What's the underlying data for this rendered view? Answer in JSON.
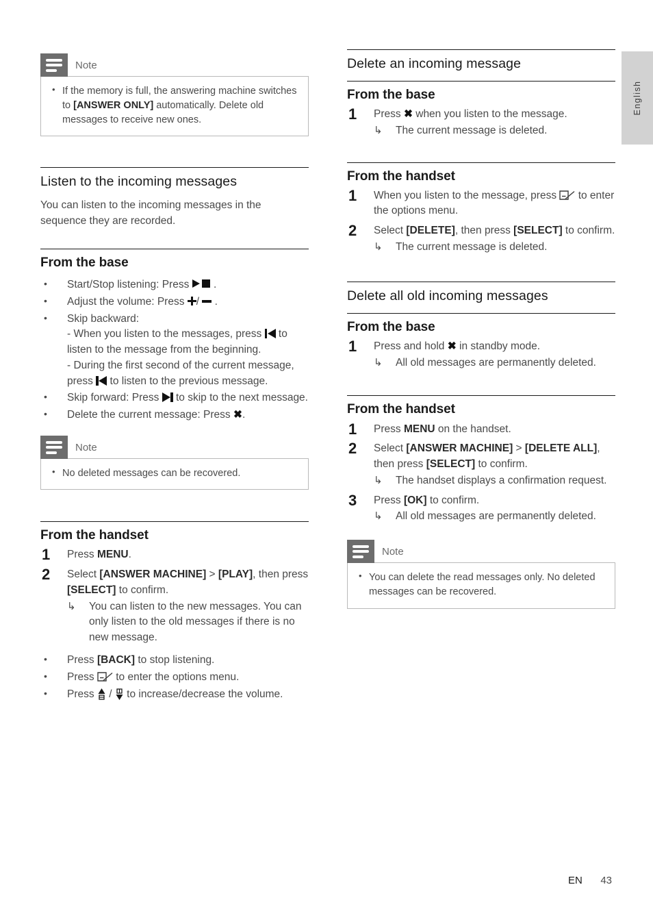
{
  "page": {
    "language_tab": "English",
    "footer_lang_code": "EN",
    "footer_page_number": "43"
  },
  "icons": {
    "note_badge": "note-lines-icon",
    "play_stop": "play-stop-icon",
    "volume_plus": "plus-icon",
    "volume_minus": "minus-icon",
    "skip_backward": "skip-backward-icon",
    "skip_forward": "skip-forward-icon",
    "delete_key": "x-delete-icon",
    "options_softkey": "softkey-options-icon",
    "volume_up_key": "volume-up-key-icon",
    "volume_down_key": "volume-down-key-icon"
  },
  "left_column": {
    "note_memory": {
      "title": "Note",
      "items": [
        {
          "pre": "If the memory is full, the answering machine switches to ",
          "bold": "[ANSWER ONLY]",
          "post": " automatically. Delete old messages to receive new ones."
        }
      ]
    },
    "listen_section": {
      "heading": "Listen to the incoming messages",
      "intro": "You can listen to the incoming messages in the sequence they are recorded.",
      "from_base": {
        "heading": "From the base",
        "bullets": {
          "start_stop_pre": "Start/Stop listening: Press ",
          "start_stop_post": " .",
          "volume_pre": "Adjust the volume: Press ",
          "volume_mid": "/",
          "volume_post": " .",
          "skip_backward_label": "Skip backward:",
          "skip_backward_line1_pre": "- When you listen to the messages, press ",
          "skip_backward_line1_post": " to listen to the message from the beginning.",
          "skip_backward_line2_pre": "- During the first second of the current message, press ",
          "skip_backward_line2_post": " to listen to the previous message.",
          "skip_forward_pre": "Skip forward: Press ",
          "skip_forward_post": " to skip to the next message.",
          "delete_pre": "Delete the current message: Press ",
          "delete_post": "."
        }
      },
      "note_recover": {
        "title": "Note",
        "items": [
          {
            "pre": "No deleted messages can be recovered.",
            "bold": "",
            "post": ""
          }
        ]
      },
      "from_handset": {
        "heading": "From the handset",
        "steps": [
          {
            "number": "1",
            "pre": "Press ",
            "bold": "MENU",
            "post": ".",
            "results": []
          },
          {
            "number": "2",
            "pre": "Select ",
            "bold": "[ANSWER MACHINE]",
            "mid": " > ",
            "bold2": "[PLAY]",
            "mid2": ", then press ",
            "bold3": "[SELECT]",
            "post": " to confirm.",
            "results": [
              "You can listen to the new messages. You can only listen to the old messages if there is no new message."
            ]
          }
        ],
        "bullets": {
          "back_pre": "Press ",
          "back_bold": "[BACK]",
          "back_post": " to stop listening.",
          "options_pre": "Press ",
          "options_post": " to enter the options menu.",
          "vol_pre": "Press ",
          "vol_mid": " / ",
          "vol_post": " to increase/decrease the volume."
        }
      }
    }
  },
  "right_column": {
    "delete_incoming": {
      "heading": "Delete an incoming message",
      "from_base": {
        "heading": "From the base",
        "steps": [
          {
            "number": "1",
            "pre": "Press ",
            "post": " when you listen to the message.",
            "results": [
              "The current message is deleted."
            ]
          }
        ]
      },
      "from_handset": {
        "heading": "From the handset",
        "steps": [
          {
            "number": "1",
            "pre": "When you listen to the message, press ",
            "post": " to enter the options menu.",
            "results": []
          },
          {
            "number": "2",
            "pre": "Select ",
            "bold": "[DELETE]",
            "mid": ", then press ",
            "bold2": "[SELECT]",
            "post": " to confirm.",
            "results": [
              "The current message is deleted."
            ]
          }
        ]
      }
    },
    "delete_all_old": {
      "heading": "Delete all old incoming messages",
      "from_base": {
        "heading": "From the base",
        "steps": [
          {
            "number": "1",
            "pre": "Press and hold ",
            "post": " in standby mode.",
            "results": [
              "All old messages are permanently deleted."
            ]
          }
        ]
      },
      "from_handset": {
        "heading": "From the handset",
        "steps": [
          {
            "number": "1",
            "pre": "Press ",
            "bold": "MENU",
            "post": " on the handset.",
            "results": []
          },
          {
            "number": "2",
            "pre": "Select ",
            "bold": "[ANSWER MACHINE]",
            "mid": " > ",
            "bold2": "[DELETE ALL]",
            "mid2": ", then press ",
            "bold3": "[SELECT]",
            "post": " to confirm.",
            "results": [
              "The handset displays a confirmation request."
            ]
          },
          {
            "number": "3",
            "pre": "Press ",
            "bold": "[OK]",
            "post": " to confirm.",
            "results": [
              "All old messages are permanently deleted."
            ]
          }
        ]
      },
      "note_read_only": {
        "title": "Note",
        "items": [
          {
            "pre": "You can delete the read messages only. No deleted messages can be recovered.",
            "bold": "",
            "post": ""
          }
        ]
      }
    }
  }
}
